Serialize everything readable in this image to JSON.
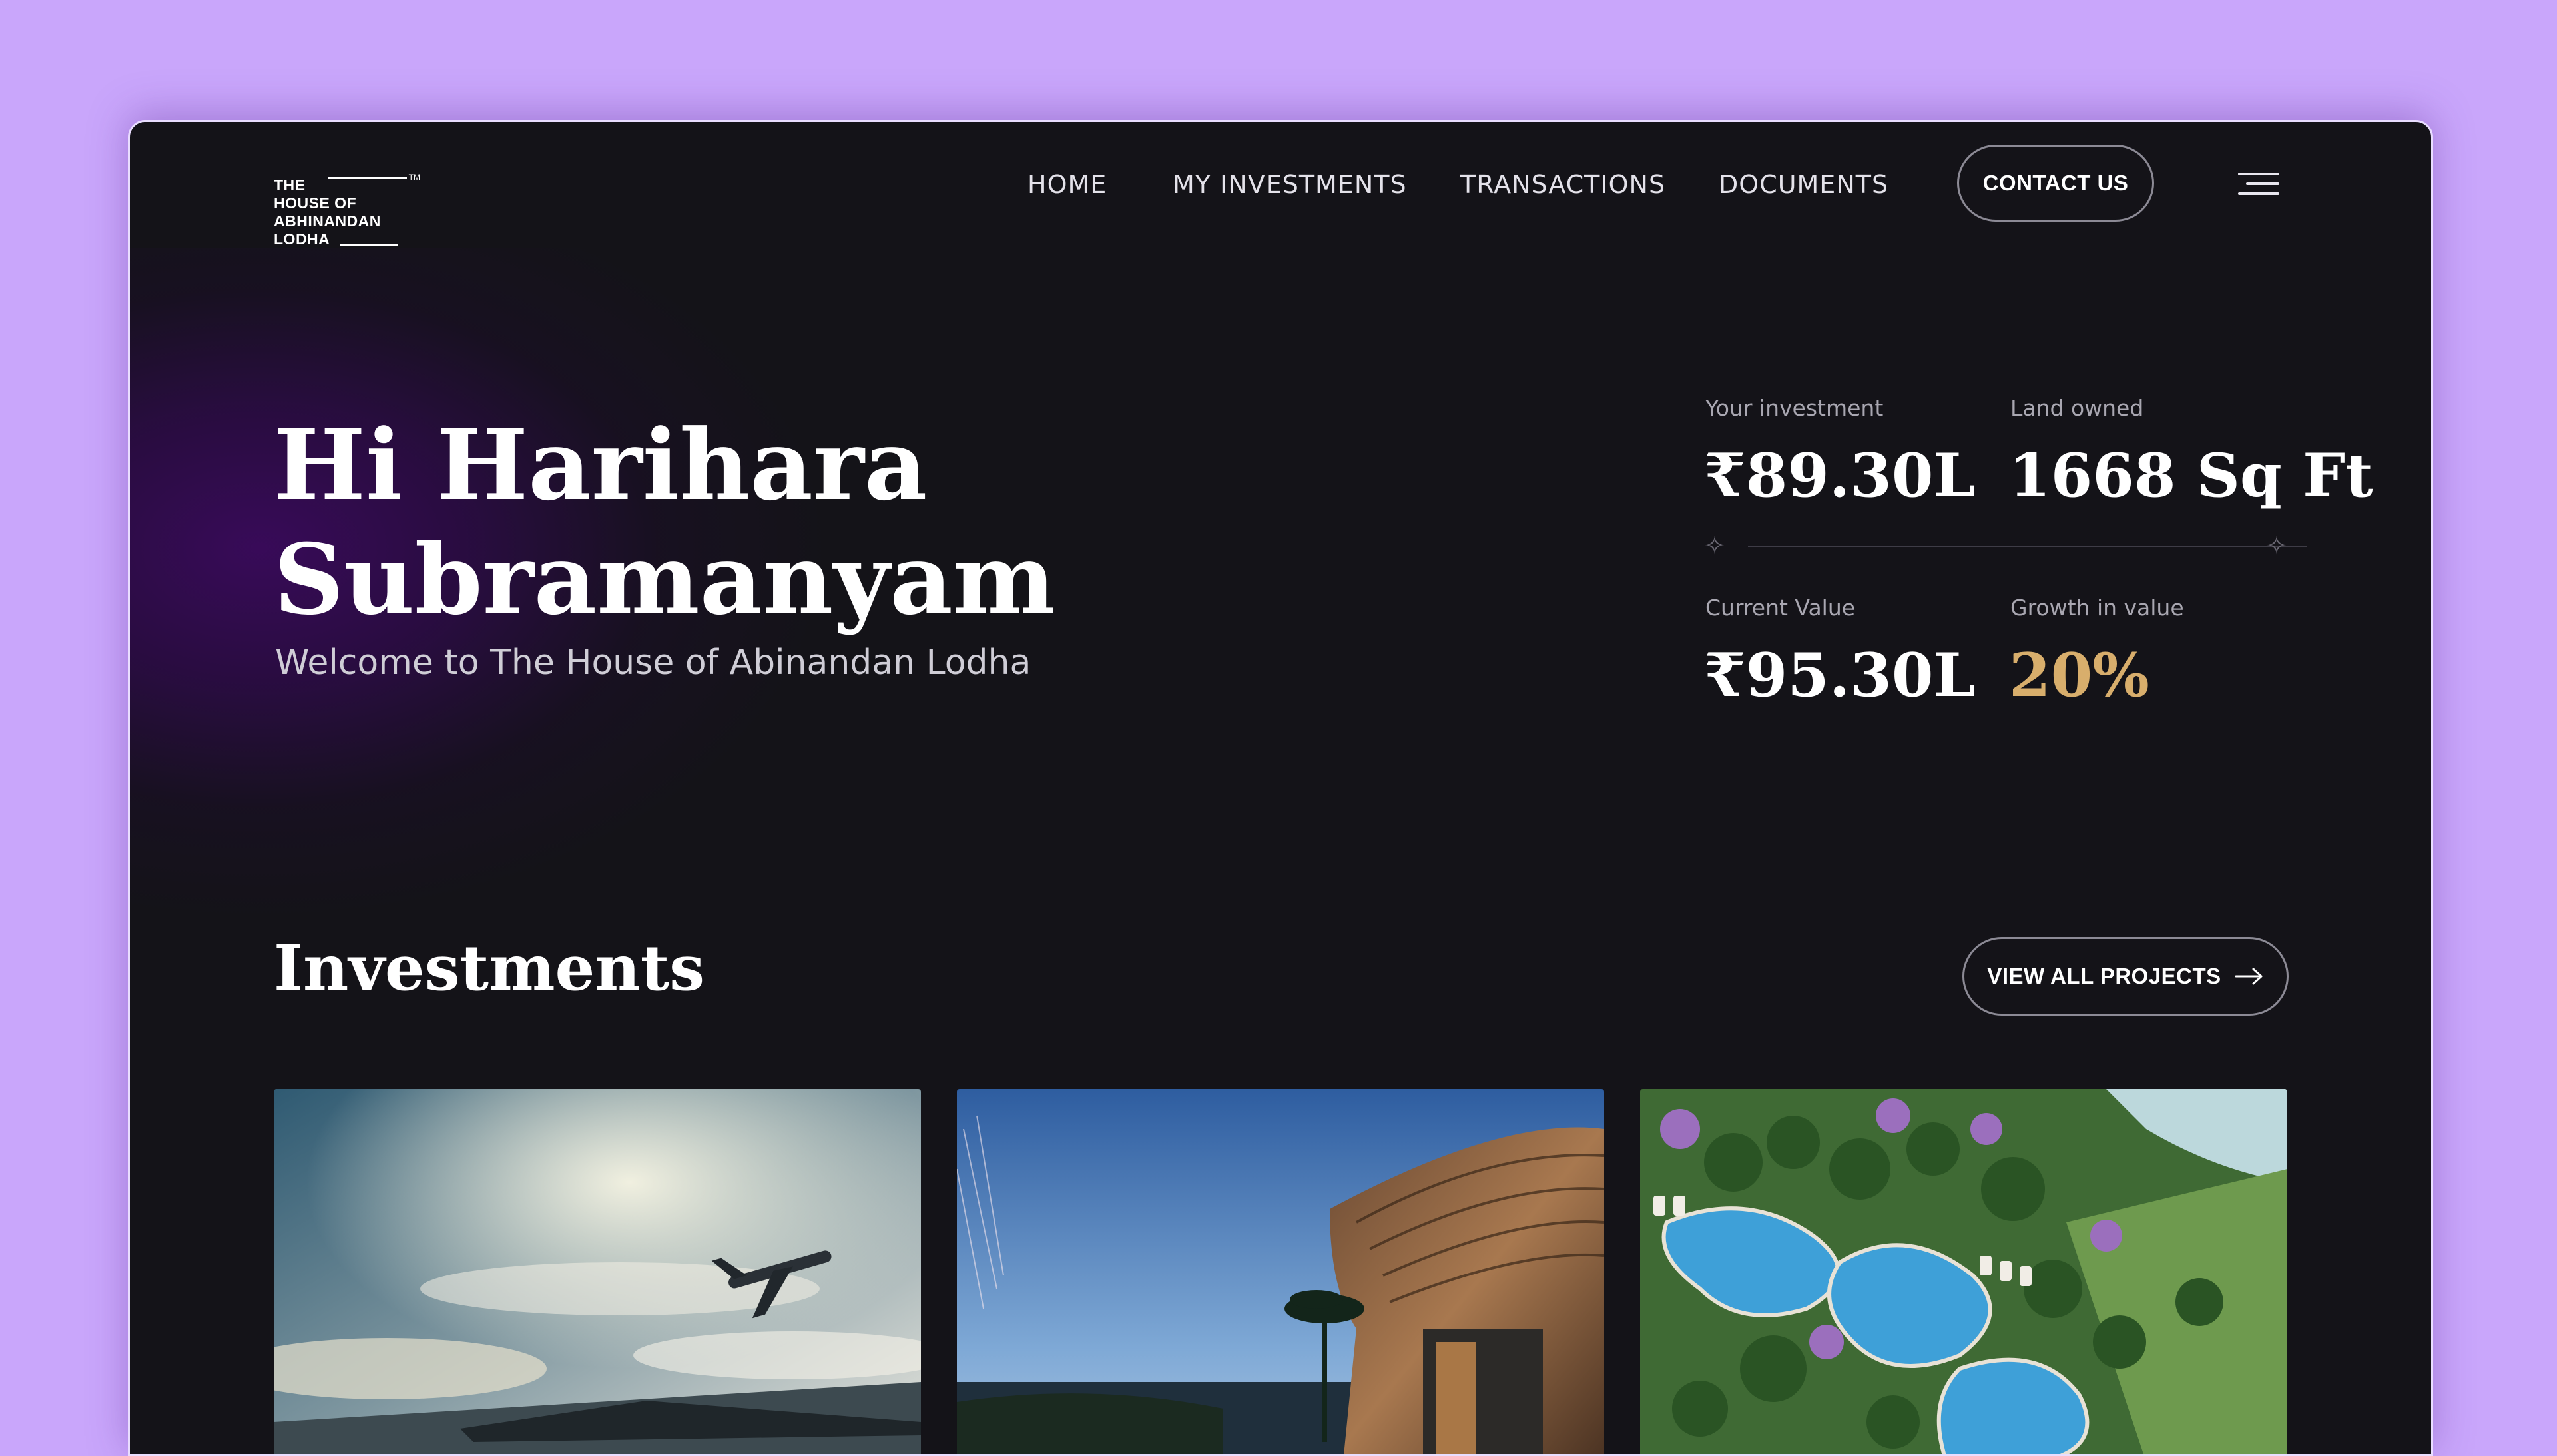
{
  "brand": {
    "logo_lines": [
      "THE",
      "HOUSE OF",
      "ABHINANDAN",
      "LODHA"
    ],
    "tm": "TM"
  },
  "nav": {
    "items": [
      {
        "label": "HOME"
      },
      {
        "label": "MY INVESTMENTS"
      },
      {
        "label": "TRANSACTIONS"
      },
      {
        "label": "DOCUMENTS"
      }
    ],
    "contact_label": "CONTACT US"
  },
  "hero": {
    "greeting_line1": "Hi Harihara",
    "greeting_line2": "Subramanyam",
    "subtitle": "Welcome to The House of Abinandan Lodha"
  },
  "stats": {
    "investment": {
      "label": "Your investment",
      "value": "₹89.30L"
    },
    "land": {
      "label": "Land owned",
      "value": "1668 Sq Ft"
    },
    "current": {
      "label": "Current Value",
      "value": "₹95.30L"
    },
    "growth": {
      "label": "Growth in value",
      "value": "20%"
    }
  },
  "investments": {
    "title": "Investments",
    "view_all_label": "VIEW ALL PROJECTS"
  },
  "colors": {
    "page_bg": "#c9a6fb",
    "app_bg": "#141318",
    "accent_gold": "#d8ae6c",
    "glow_purple": "#3a0a5c"
  }
}
